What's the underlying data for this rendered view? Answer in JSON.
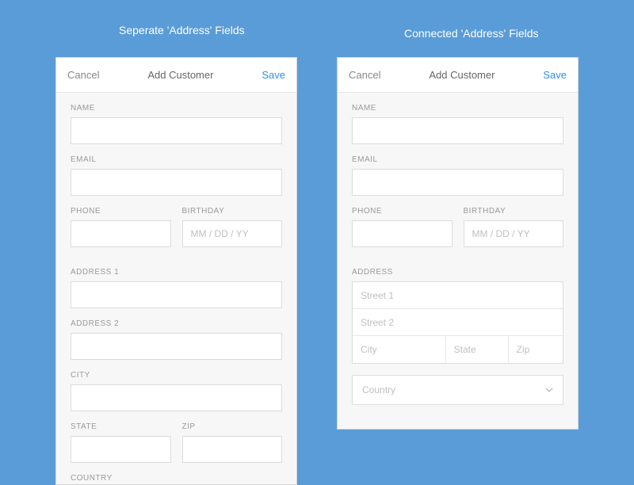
{
  "titles": {
    "left": "Seperate 'Address' Fields",
    "right": "Connected 'Address' Fields"
  },
  "header": {
    "cancel": "Cancel",
    "title": "Add Customer",
    "save": "Save"
  },
  "labels": {
    "name": "NAME",
    "email": "EMAIL",
    "phone": "PHONE",
    "birthday": "BIRTHDAY",
    "address1": "ADDRESS 1",
    "address2": "ADDRESS 2",
    "city": "CITY",
    "state": "STATE",
    "zip": "ZIP",
    "country": "COUNTRY",
    "address": "ADDRESS"
  },
  "placeholders": {
    "birthday": "MM / DD / YY",
    "street1": "Street 1",
    "street2": "Street 2",
    "city": "City",
    "state": "State",
    "zip": "Zip",
    "country": "Country"
  }
}
